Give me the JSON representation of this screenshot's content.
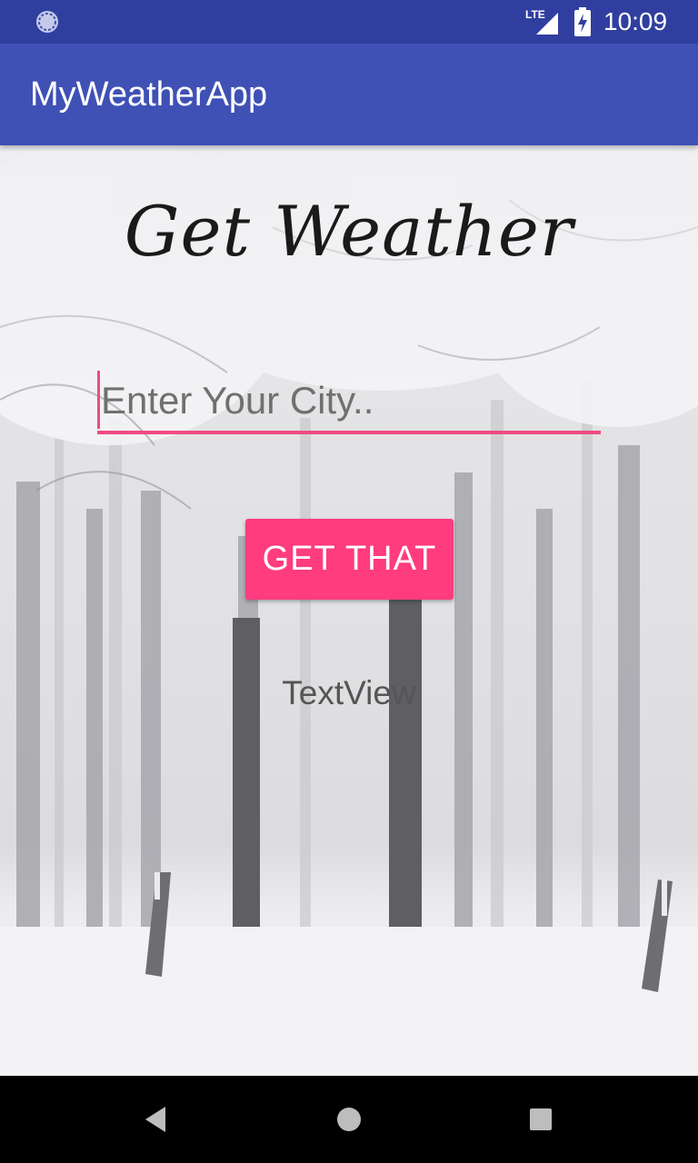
{
  "status_bar": {
    "network_label": "LTE",
    "time": "10:09",
    "icons": [
      "notification-icon",
      "lte-signal-icon",
      "battery-charging-icon"
    ]
  },
  "app_bar": {
    "title": "MyWeatherApp",
    "color": "#3f51b5",
    "status_color": "#303f9f"
  },
  "main": {
    "heading": "Get Weather",
    "city_input": {
      "value": "",
      "placeholder": "Enter Your City.."
    },
    "get_button_label": "GET THAT",
    "result_text": "TextView",
    "accent_color": "#ff3c7d"
  },
  "nav_bar": {
    "icons": [
      "back-icon",
      "home-icon",
      "recents-icon"
    ]
  }
}
